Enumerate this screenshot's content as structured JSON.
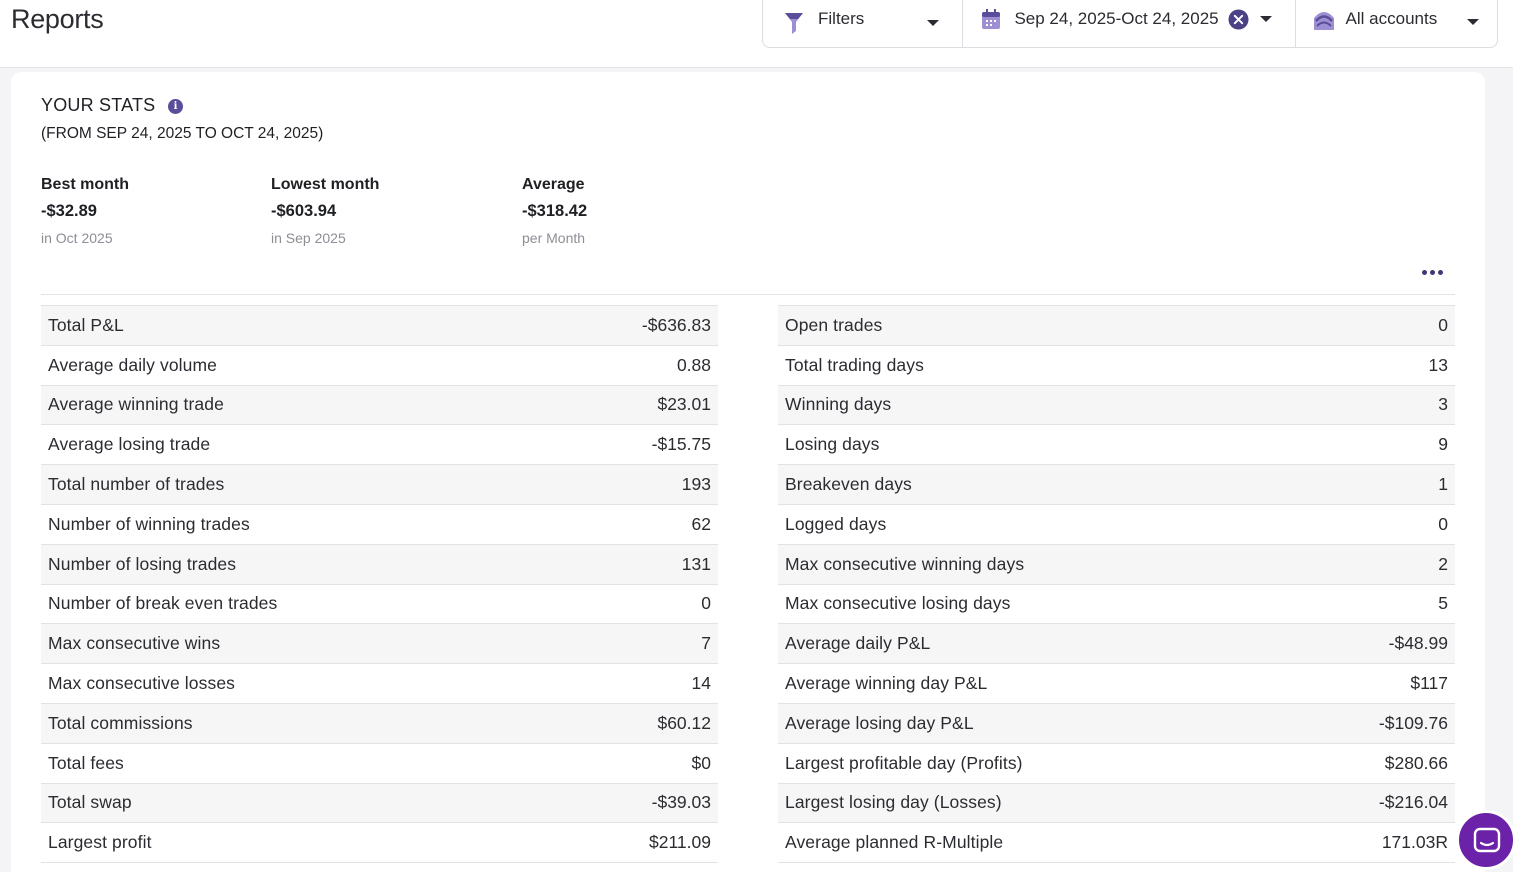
{
  "page": {
    "title": "Reports"
  },
  "filters": {
    "filters_label": "Filters",
    "date_range": "Sep 24, 2025-Oct 24, 2025",
    "accounts_label": "All accounts"
  },
  "stats": {
    "title": "YOUR STATS",
    "range": "(FROM SEP 24, 2025 TO OCT 24, 2025)",
    "summary": [
      {
        "label": "Best month",
        "value": "-$32.89",
        "note": "in Oct 2025"
      },
      {
        "label": "Lowest month",
        "value": "-$603.94",
        "note": "in Sep 2025"
      },
      {
        "label": "Average",
        "value": "-$318.42",
        "note": "per Month"
      }
    ],
    "left_rows": [
      {
        "label": "Total P&L",
        "value": "-$636.83"
      },
      {
        "label": "Average daily volume",
        "value": "0.88"
      },
      {
        "label": "Average winning trade",
        "value": "$23.01"
      },
      {
        "label": "Average losing trade",
        "value": "-$15.75"
      },
      {
        "label": "Total number of trades",
        "value": "193"
      },
      {
        "label": "Number of winning trades",
        "value": "62"
      },
      {
        "label": "Number of losing trades",
        "value": "131"
      },
      {
        "label": "Number of break even trades",
        "value": "0"
      },
      {
        "label": "Max consecutive wins",
        "value": "7"
      },
      {
        "label": "Max consecutive losses",
        "value": "14"
      },
      {
        "label": "Total commissions",
        "value": "$60.12"
      },
      {
        "label": "Total fees",
        "value": "$0"
      },
      {
        "label": "Total swap",
        "value": "-$39.03"
      },
      {
        "label": "Largest profit",
        "value": "$211.09"
      }
    ],
    "right_rows": [
      {
        "label": "Open trades",
        "value": "0"
      },
      {
        "label": "Total trading days",
        "value": "13"
      },
      {
        "label": "Winning days",
        "value": "3"
      },
      {
        "label": "Losing days",
        "value": "9"
      },
      {
        "label": "Breakeven days",
        "value": "1"
      },
      {
        "label": "Logged days",
        "value": "0"
      },
      {
        "label": "Max consecutive winning days",
        "value": "2"
      },
      {
        "label": "Max consecutive losing days",
        "value": "5"
      },
      {
        "label": "Average daily P&L",
        "value": "-$48.99"
      },
      {
        "label": "Average winning day P&L",
        "value": "$117"
      },
      {
        "label": "Average losing day P&L",
        "value": "-$109.76"
      },
      {
        "label": "Largest profitable day (Profits)",
        "value": "$280.66"
      },
      {
        "label": "Largest losing day (Losses)",
        "value": "-$216.04"
      },
      {
        "label": "Average planned R-Multiple",
        "value": "171.03R"
      }
    ]
  },
  "icons": {
    "filters": "funnel-icon",
    "date": "calendar-icon",
    "clear": "clear-circle-icon",
    "accounts": "account-stack-icon",
    "info": "info-icon",
    "more": "more-dots-icon",
    "chat": "chat-icon"
  },
  "colors": {
    "accent": "#5c4d9a",
    "chat_button": "#6b21a8",
    "page_bg": "#f4f4f6"
  }
}
